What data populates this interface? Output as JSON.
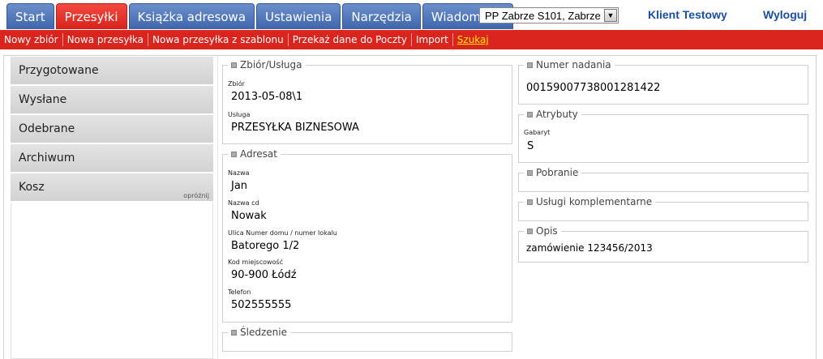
{
  "tabs": [
    {
      "label": "Start",
      "active": false
    },
    {
      "label": "Przesyłki",
      "active": true
    },
    {
      "label": "Książka adresowa",
      "active": false
    },
    {
      "label": "Ustawienia",
      "active": false
    },
    {
      "label": "Narzędzia",
      "active": false
    },
    {
      "label": "Wiadomości",
      "active": false
    }
  ],
  "post_office_select": {
    "value": "PP Zabrze S101, Zabrze"
  },
  "header": {
    "client": "Klient Testowy",
    "logout": "Wyloguj"
  },
  "subnav": [
    {
      "label": "Nowy zbiór",
      "active": false
    },
    {
      "label": "Nowa przesyłka",
      "active": false
    },
    {
      "label": "Nowa przesyłka z szablonu",
      "active": false
    },
    {
      "label": "Przekaż dane do Poczty",
      "active": false
    },
    {
      "label": "Import",
      "active": false
    },
    {
      "label": "Szukaj",
      "active": true
    }
  ],
  "sidebar": {
    "items": [
      {
        "label": "Przygotowane"
      },
      {
        "label": "Wysłane"
      },
      {
        "label": "Odebrane"
      },
      {
        "label": "Archiwum"
      },
      {
        "label": "Kosz",
        "action": "opróżnij"
      }
    ]
  },
  "zbior_usluga": {
    "legend": "Zbiór/Usługa",
    "zbior_label": "Zbiór",
    "zbior_value": "2013-05-08\\1",
    "usluga_label": "Usługa",
    "usluga_value": "PRZESYŁKA BIZNESOWA"
  },
  "adresat": {
    "legend": "Adresat",
    "nazwa_label": "Nazwa",
    "nazwa_value": "Jan",
    "nazwa_cd_label": "Nazwa cd",
    "nazwa_cd_value": "Nowak",
    "ulica_label": "Ulica Numer domu / numer lokalu",
    "ulica_value": "Batorego 1/2",
    "kod_label": "Kod miejscowość",
    "kod_value": "90-900 Łódź",
    "telefon_label": "Telefon",
    "telefon_value": "502555555"
  },
  "sledzenie": {
    "legend": "Śledzenie"
  },
  "numer_nadania": {
    "legend": "Numer nadania",
    "value": "00159007738001281422"
  },
  "atrybuty": {
    "legend": "Atrybuty",
    "gabaryt_label": "Gabaryt",
    "gabaryt_value": "S"
  },
  "pobranie": {
    "legend": "Pobranie"
  },
  "uslugi_komplementarne": {
    "legend": "Usługi komplementarne"
  },
  "opis": {
    "legend": "Opis",
    "value": "zamówienie 123456/2013"
  }
}
